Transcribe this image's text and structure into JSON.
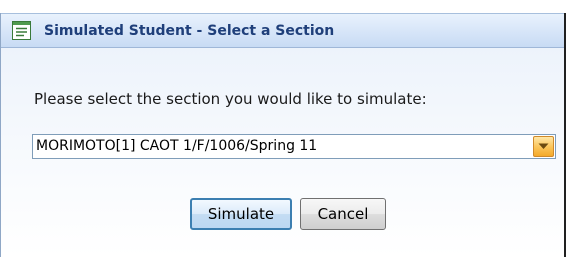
{
  "dialog": {
    "title": "Simulated Student - Select a Section",
    "title_icon": "list-window-icon",
    "prompt": "Please select the section you would like to simulate:",
    "section_select": {
      "selected_value": "MORIMOTO[1] CAOT 1/F/1006/Spring 11",
      "arrow_icon": "chevron-down-icon"
    },
    "buttons": {
      "simulate_label": "Simulate",
      "cancel_label": "Cancel"
    }
  },
  "colors": {
    "title_text": "#1f3f7a",
    "titlebar_bg": "#d6e5f8",
    "dropdown_accent": "#f4a92a",
    "primary_button_border": "#3c7fb1"
  }
}
